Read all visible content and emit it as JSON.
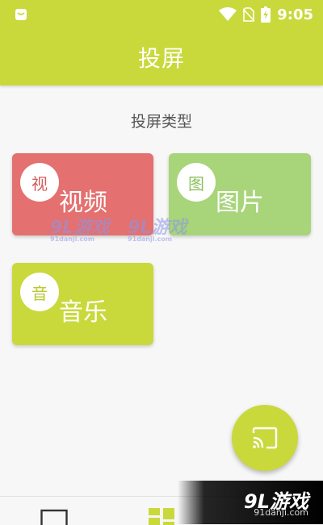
{
  "status_bar": {
    "time": "9:05"
  },
  "app_bar": {
    "title": "投屏"
  },
  "section": {
    "title": "投屏类型"
  },
  "tiles": [
    {
      "label": "视频",
      "badge": "视",
      "color": "#e47070"
    },
    {
      "label": "图片",
      "badge": "图",
      "color": "#a8d47a"
    },
    {
      "label": "音乐",
      "badge": "音",
      "color": "#c9d93c"
    }
  ],
  "watermarks": [
    {
      "logo": "9L游戏",
      "sub": "91danji.com"
    },
    {
      "logo": "9L游戏",
      "sub": "91danji.com"
    }
  ],
  "corner_watermark": {
    "logo": "9L游戏",
    "sub": "91danji.com"
  },
  "fab": {
    "icon": "cast-icon"
  },
  "bottom_nav": {
    "items": [
      "square-icon",
      "grid-icon"
    ]
  },
  "colors": {
    "accent": "#c9d93c",
    "video": "#e47070",
    "image": "#a8d47a"
  }
}
